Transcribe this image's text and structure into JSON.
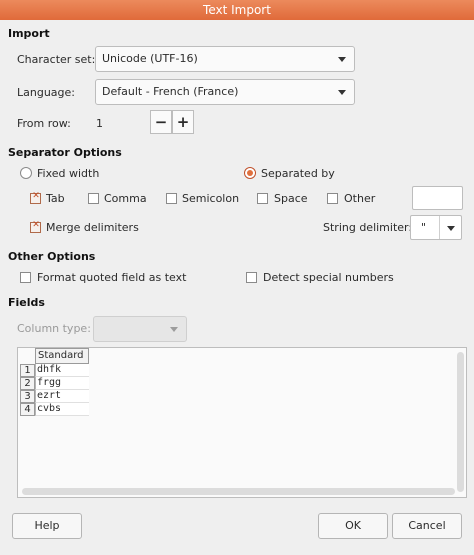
{
  "window": {
    "title": "Text Import"
  },
  "import": {
    "heading": "Import",
    "charset_label": "Character set:",
    "charset_value": "Unicode (UTF-16)",
    "language_label": "Language:",
    "language_value": "Default - French (France)",
    "fromrow_label": "From row:",
    "fromrow_value": "1",
    "minus": "−",
    "plus": "+"
  },
  "separator": {
    "heading": "Separator Options",
    "fixed_width": "Fixed width",
    "separated_by": "Separated by",
    "tab": "Tab",
    "comma": "Comma",
    "semicolon": "Semicolon",
    "space": "Space",
    "other": "Other",
    "merge": "Merge delimiters",
    "string_delim_label": "String delimiter:",
    "string_delim_value": "\""
  },
  "other": {
    "heading": "Other Options",
    "format_quoted": "Format quoted field as text",
    "detect_special": "Detect special numbers"
  },
  "fields": {
    "heading": "Fields",
    "column_type_label": "Column type:",
    "column_header": "Standard",
    "rows": [
      {
        "num": "1",
        "value": "dhfk"
      },
      {
        "num": "2",
        "value": "frgg"
      },
      {
        "num": "3",
        "value": "ezrt"
      },
      {
        "num": "4",
        "value": "cvbs"
      }
    ]
  },
  "buttons": {
    "help": "Help",
    "ok": "OK",
    "cancel": "Cancel"
  }
}
